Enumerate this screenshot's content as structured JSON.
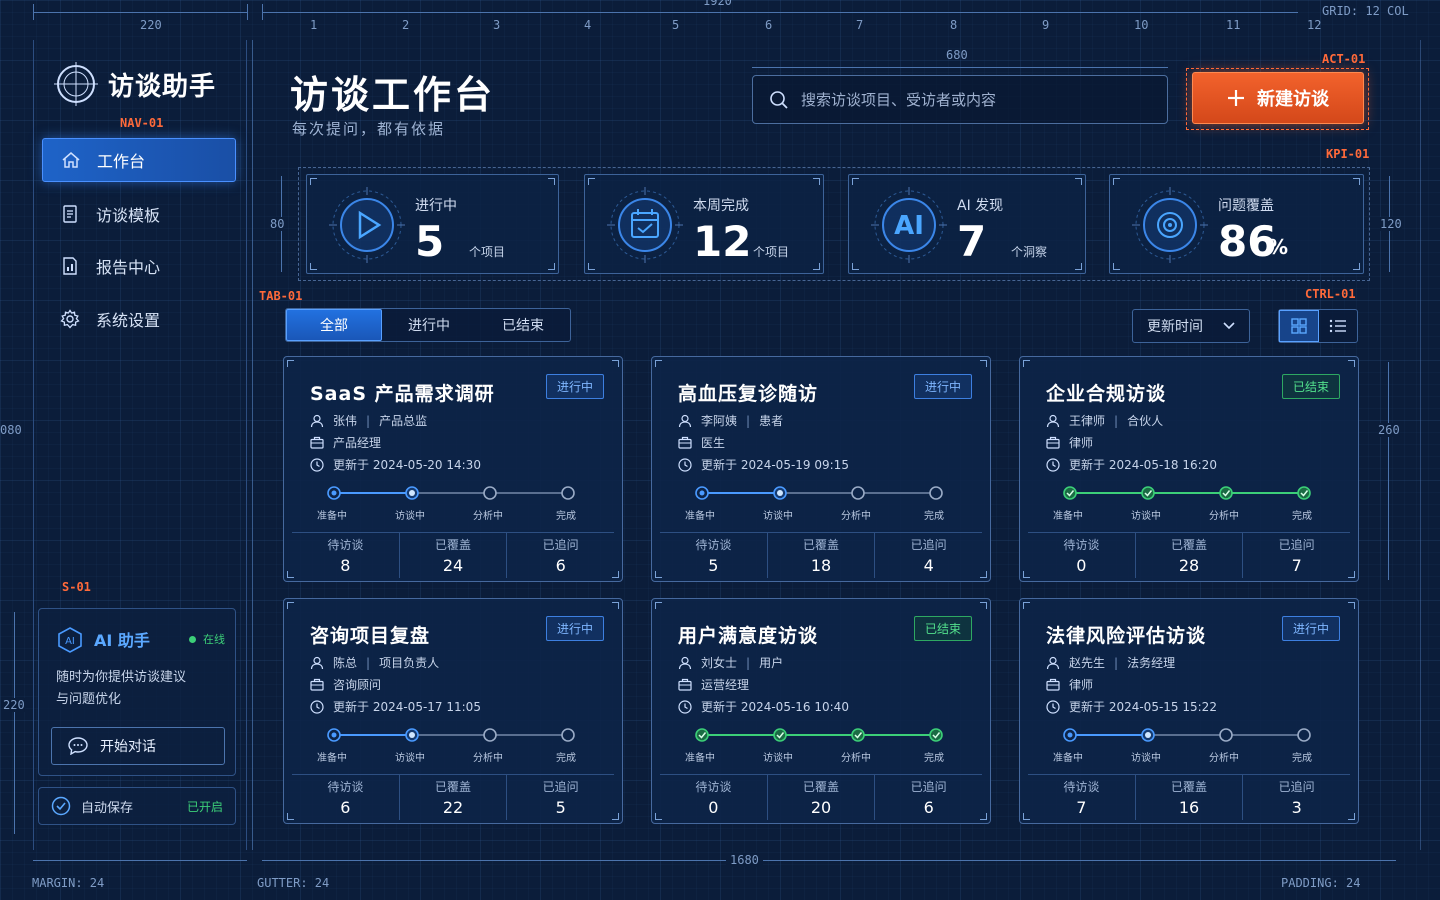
{
  "blueprint": {
    "width_label": "1920",
    "sidebar_width": "220",
    "columns": [
      "1",
      "2",
      "3",
      "4",
      "5",
      "6",
      "7",
      "8",
      "9",
      "10",
      "11",
      "12"
    ],
    "grid_label": "GRID: 12 COL",
    "search_width": "680",
    "kpi_height_left": "80",
    "kpi_height_right": "120",
    "height_left": "080",
    "card_height": "260",
    "assist_height": "220",
    "content_width": "1680",
    "margin_label": "MARGIN: 24",
    "gutter_label": "GUTTER: 24",
    "padding_label": "PADDING: 24",
    "tags": {
      "nav": "NAV-01",
      "act": "ACT-01",
      "kpi": "KPI-01",
      "tab": "TAB-01",
      "ctrl": "CTRL-01",
      "side": "S-01"
    }
  },
  "app": {
    "title": "访谈助手"
  },
  "nav": [
    {
      "label": "工作台",
      "icon": "home-icon",
      "active": true
    },
    {
      "label": "访谈模板",
      "icon": "template-icon",
      "active": false
    },
    {
      "label": "报告中心",
      "icon": "report-icon",
      "active": false
    },
    {
      "label": "系统设置",
      "icon": "gear-icon",
      "active": false
    }
  ],
  "assistant": {
    "title": "AI 助手",
    "status": "在线",
    "desc_line1": "随时为你提供访谈建议",
    "desc_line2": "与问题优化",
    "button": "开始对话"
  },
  "autosave": {
    "label": "自动保存",
    "status": "已开启"
  },
  "header": {
    "title": "访谈工作台",
    "subtitle": "每次提问，都有依据",
    "search_placeholder": "搜索访谈项目、受访者或内容",
    "new_button": "新建访谈"
  },
  "kpis": [
    {
      "label": "进行中",
      "value": "5",
      "unit": "个项目",
      "icon": "play-icon"
    },
    {
      "label": "本周完成",
      "value": "12",
      "unit": "个项目",
      "icon": "calendar-check-icon"
    },
    {
      "label": "AI 发现",
      "value": "7",
      "unit": "个洞察",
      "icon": "ai-icon"
    },
    {
      "label": "问题覆盖",
      "value": "86",
      "unit": "%",
      "icon": "target-icon"
    }
  ],
  "tabs": [
    "全部",
    "进行中",
    "已结束"
  ],
  "sort": {
    "label": "更新时间"
  },
  "steps_labels": [
    "准备中",
    "访谈中",
    "分析中",
    "完成"
  ],
  "stat_labels": [
    "待访谈",
    "已覆盖",
    "已追问"
  ],
  "cards": [
    {
      "title": "SaaS 产品需求调研",
      "status": "进行中",
      "done": false,
      "person": "张伟",
      "role": "产品总监",
      "position": "产品经理",
      "updated": "更新于 2024-05-20 14:30",
      "pending": "8",
      "covered": "24",
      "followed": "6"
    },
    {
      "title": "高血压复诊随访",
      "status": "进行中",
      "done": false,
      "person": "李阿姨",
      "role": "患者",
      "position": "医生",
      "updated": "更新于 2024-05-19 09:15",
      "pending": "5",
      "covered": "18",
      "followed": "4"
    },
    {
      "title": "企业合规访谈",
      "status": "已结束",
      "done": true,
      "person": "王律师",
      "role": "合伙人",
      "position": "律师",
      "updated": "更新于 2024-05-18 16:20",
      "pending": "0",
      "covered": "28",
      "followed": "7"
    },
    {
      "title": "咨询项目复盘",
      "status": "进行中",
      "done": false,
      "person": "陈总",
      "role": "项目负责人",
      "position": "咨询顾问",
      "updated": "更新于 2024-05-17 11:05",
      "pending": "6",
      "covered": "22",
      "followed": "5"
    },
    {
      "title": "用户满意度访谈",
      "status": "已结束",
      "done": true,
      "person": "刘女士",
      "role": "用户",
      "position": "运营经理",
      "updated": "更新于 2024-05-16 10:40",
      "pending": "0",
      "covered": "20",
      "followed": "6"
    },
    {
      "title": "法律风险评估访谈",
      "status": "进行中",
      "done": false,
      "person": "赵先生",
      "role": "法务经理",
      "position": "律师",
      "updated": "更新于 2024-05-15 15:22",
      "pending": "7",
      "covered": "16",
      "followed": "3"
    }
  ],
  "colors": {
    "accent": "#2a7bff",
    "orange": "#f2622c",
    "green": "#3ccf78",
    "bg": "#0b1d3a"
  }
}
